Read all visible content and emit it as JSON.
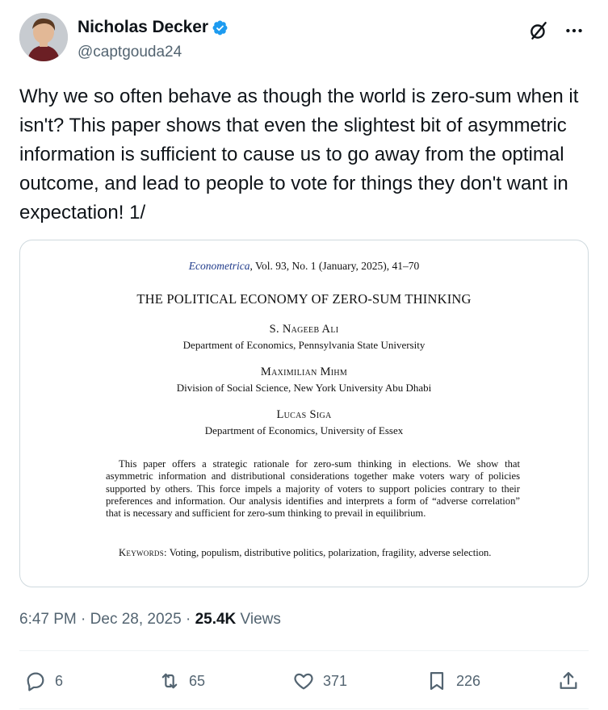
{
  "author": {
    "display_name": "Nicholas Decker",
    "handle": "@captgouda24",
    "verified_icon": "verified-badge-icon",
    "avatar": "avatar"
  },
  "header_actions": {
    "grok_icon": "grok-icon",
    "more_icon": "more-icon"
  },
  "tweet": {
    "text": "Why we so often behave as though the world is zero-sum when it isn't? This paper shows that even the slightest bit of asymmetric information is sufficient to cause us to go away from the optimal outcome, and lead to people to vote for things they don't want in expectation! 1/"
  },
  "paper": {
    "journal_name": "Econometrica",
    "journal_info": ", Vol. 93, No. 1 (January, 2025), 41–70",
    "title": "THE POLITICAL ECONOMY OF ZERO-SUM THINKING",
    "authors": [
      {
        "name": "S. Nageeb Ali",
        "affiliation": "Department of Economics, Pennsylvania State University"
      },
      {
        "name": "Maximilian Mihm",
        "affiliation": "Division of Social Science, New York University Abu Dhabi"
      },
      {
        "name": "Lucas Siga",
        "affiliation": "Department of Economics, University of Essex"
      }
    ],
    "abstract": "This paper offers a strategic rationale for zero-sum thinking in elections. We show that asymmetric information and distributional considerations together make voters wary of policies supported by others. This force impels a majority of voters to support policies contrary to their preferences and information. Our analysis identifies and interprets a form of “adverse correlation” that is necessary and sufficient for zero-sum thinking to prevail in equilibrium.",
    "keywords_label": "Keywords:",
    "keywords": " Voting, populism, distributive politics, polarization, fragility, adverse selection."
  },
  "meta": {
    "time": "6:47 PM",
    "sep1": " · ",
    "date": "Dec 28, 2025",
    "sep2": " · ",
    "views_count": "25.4K",
    "views_label": " Views"
  },
  "actions": {
    "replies": "6",
    "reposts": "65",
    "likes": "371",
    "bookmarks": "226"
  },
  "colors": {
    "text": "#0f1419",
    "secondary": "#536471",
    "verified": "#1d9bf0",
    "border": "#cfd9de",
    "divider": "#eff3f4",
    "journal": "#1f3a8a"
  }
}
